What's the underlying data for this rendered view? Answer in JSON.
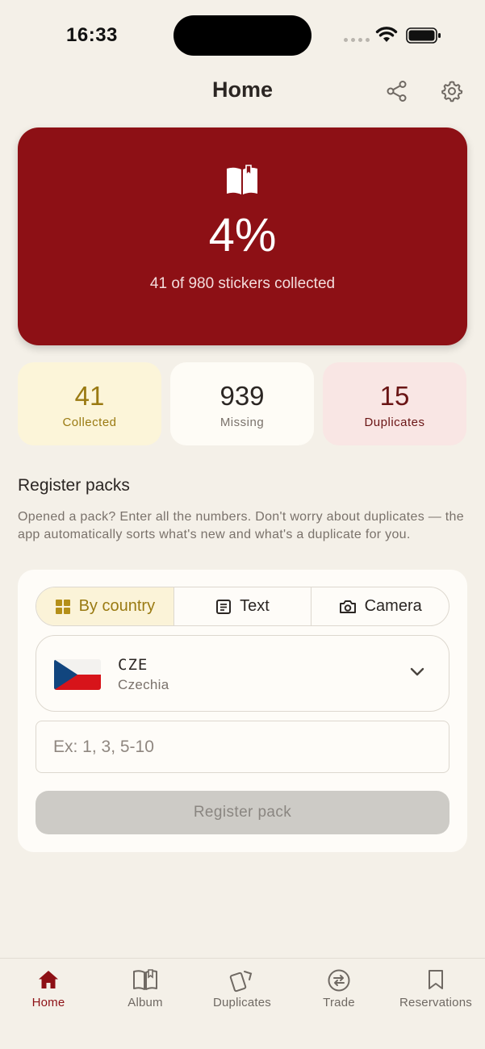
{
  "status_bar": {
    "time": "16:33"
  },
  "header": {
    "title": "Home"
  },
  "progress": {
    "percent_text": "4%",
    "collected_fraction": 0.04,
    "summary": "41 of 980 stickers collected"
  },
  "stats": {
    "collected": {
      "value": "41",
      "label": "Collected",
      "color": "#9a7a12"
    },
    "missing": {
      "value": "939",
      "label": "Missing",
      "color": "#2b2623"
    },
    "duplicates": {
      "value": "15",
      "label": "Duplicates",
      "color": "#6a1515"
    }
  },
  "register": {
    "title": "Register packs",
    "description": "Opened a pack? Enter all the numbers. Don't worry about duplicates — the app automatically sorts what's new and what's a duplicate for you.",
    "modes": [
      {
        "label": "By country",
        "icon": "grid-icon",
        "active": true
      },
      {
        "label": "Text",
        "icon": "document-icon",
        "active": false
      },
      {
        "label": "Camera",
        "icon": "camera-icon",
        "active": false
      }
    ],
    "country": {
      "code": "CZE",
      "name": "Czechia"
    },
    "numbers_placeholder": "Ex: 1, 3, 5-10",
    "numbers_value": "",
    "button_label": "Register pack"
  },
  "tabs": [
    {
      "label": "Home",
      "icon": "home-icon",
      "active": true
    },
    {
      "label": "Album",
      "icon": "book-icon",
      "active": false
    },
    {
      "label": "Duplicates",
      "icon": "cards-icon",
      "active": false
    },
    {
      "label": "Trade",
      "icon": "swap-icon",
      "active": false
    },
    {
      "label": "Reservations",
      "icon": "bookmark-icon",
      "active": false
    }
  ],
  "colors": {
    "background": "#f4f0e8",
    "brand_red": "#8d1015",
    "gold": "#9a7a12",
    "muted_text": "#7a726b"
  }
}
